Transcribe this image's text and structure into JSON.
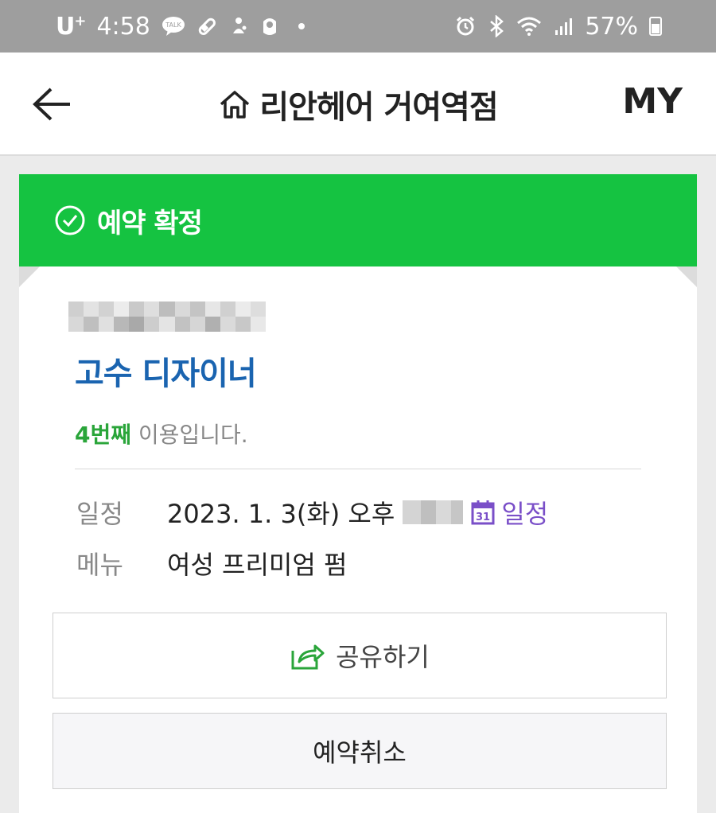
{
  "status_bar": {
    "carrier": "U",
    "carrier_sup": "+",
    "time": "4:58",
    "kakao_badge": "TALK",
    "battery": "57%",
    "icons": [
      "kakaotalk-icon",
      "pill-icon",
      "stroller-icon",
      "baby-icon",
      "alarm-icon",
      "bluetooth-icon",
      "wifi-icon",
      "signal-icon",
      "battery-icon"
    ]
  },
  "header": {
    "title": "리안헤어 거여역점",
    "my_label": "MY"
  },
  "banner": {
    "title": "예약 확정",
    "color": "#15c341"
  },
  "reservation": {
    "designer": "고수 디자이너",
    "visit_count": "4번째",
    "visit_suffix": " 이용입니다.",
    "schedule_label": "일정",
    "schedule_value": "2023. 1. 3(화) 오후",
    "calendar_link": "일정",
    "calendar_day": "31",
    "menu_label": "메뉴",
    "menu_value": "여성 프리미엄 펌"
  },
  "actions": {
    "share_label": "공유하기",
    "cancel_label": "예약취소"
  },
  "colors": {
    "accent_green": "#15c341",
    "designer_blue": "#1a64b0",
    "calendar_purple": "#7a4fc8"
  }
}
